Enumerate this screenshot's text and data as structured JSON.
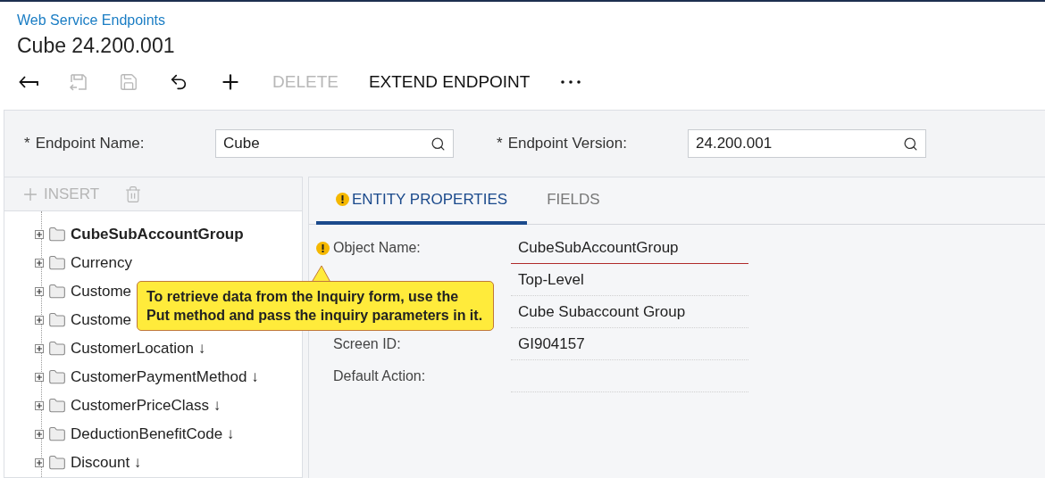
{
  "breadcrumb": "Web Service Endpoints",
  "title": "Cube 24.200.001",
  "toolbar": [
    {
      "kind": "back",
      "disabled": false
    },
    {
      "kind": "save-close",
      "disabled": true
    },
    {
      "kind": "save",
      "disabled": true
    },
    {
      "kind": "undo",
      "disabled": false
    },
    {
      "kind": "add",
      "disabled": false
    },
    {
      "kind": "text",
      "label": "DELETE",
      "disabled": true
    },
    {
      "kind": "text",
      "label": "EXTEND ENDPOINT",
      "disabled": false
    },
    {
      "kind": "more",
      "disabled": false
    }
  ],
  "form": [
    {
      "marker": "*",
      "label": "Endpoint Name:",
      "value": "Cube"
    },
    {
      "marker": "*",
      "label": "Endpoint Version:",
      "value": "24.200.001"
    }
  ],
  "tree_toolbar": {
    "insert": {
      "label": "INSERT",
      "disabled": true
    },
    "delete": {
      "disabled": true
    }
  },
  "tree": [
    {
      "label": "CubeSubAccountGroup",
      "selected": true
    },
    {
      "label": "Currency",
      "selected": false
    },
    {
      "label": "Custome",
      "selected": false
    },
    {
      "label": "Custome",
      "selected": false
    },
    {
      "label": "CustomerLocation ↓",
      "selected": false
    },
    {
      "label": "CustomerPaymentMethod ↓",
      "selected": false
    },
    {
      "label": "CustomerPriceClass ↓",
      "selected": false
    },
    {
      "label": "DeductionBenefitCode ↓",
      "selected": false
    },
    {
      "label": "Discount ↓",
      "selected": false
    }
  ],
  "tabs": [
    {
      "label": "ENTITY PROPERTIES",
      "selected": true,
      "warning": true
    },
    {
      "label": "FIELDS",
      "selected": false,
      "warning": false
    }
  ],
  "properties": [
    {
      "label": "Object Name:",
      "value": "CubeSubAccountGroup",
      "warning": true,
      "error": true
    },
    {
      "value": "Top-Level",
      "warning": false,
      "error": false
    },
    {
      "value": "Cube Subaccount Group",
      "warning": false,
      "error": false
    },
    {
      "label": "Screen ID:",
      "value": "GI904157",
      "warning": false,
      "error": false
    },
    {
      "label": "Default Action:",
      "warning": false,
      "error": false
    }
  ],
  "tooltip": {
    "text": "To retrieve data from the Inquiry form, use the Put method and pass the inquiry parameters in it."
  }
}
